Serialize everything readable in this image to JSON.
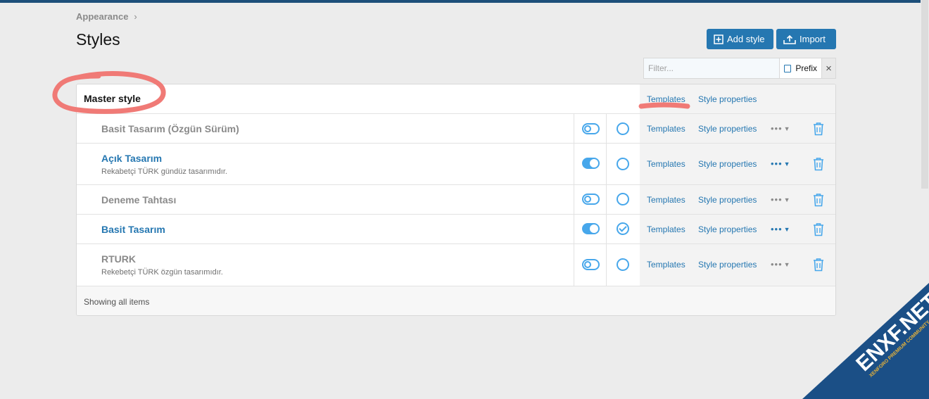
{
  "breadcrumb": {
    "label": "Appearance",
    "sep": "›"
  },
  "page": {
    "title": "Styles"
  },
  "toolbar": {
    "add_label": "Add style",
    "import_label": "Import"
  },
  "filter": {
    "placeholder": "Filter...",
    "prefix_label": "Prefix",
    "clear_icon": "×"
  },
  "master": {
    "title": "Master style",
    "templates": "Templates",
    "properties": "Style properties"
  },
  "styles": [
    {
      "title": "Basit Tasarım (Özgün Sürüm)",
      "desc": "",
      "enabled": false,
      "default": false,
      "templates": "Templates",
      "properties": "Style properties"
    },
    {
      "title": "Açık Tasarım",
      "desc": "Rekabetçi TÜRK gündüz tasarımıdır.",
      "enabled": true,
      "default": false,
      "templates": "Templates",
      "properties": "Style properties"
    },
    {
      "title": "Deneme Tahtası",
      "desc": "",
      "enabled": false,
      "default": false,
      "templates": "Templates",
      "properties": "Style properties"
    },
    {
      "title": "Basit Tasarım",
      "desc": "",
      "enabled": true,
      "default": true,
      "templates": "Templates",
      "properties": "Style properties"
    },
    {
      "title": "RTURK",
      "desc": "Rekebetçi TÜRK özgün tasarımıdır.",
      "enabled": false,
      "default": false,
      "templates": "Templates",
      "properties": "Style properties"
    }
  ],
  "footer": {
    "text": "Showing all items"
  },
  "watermark": {
    "text": "ENXF.NET",
    "sub": "XENFORO PREMIUM COMMUNITY"
  },
  "colors": {
    "accent": "#2577b1",
    "toggle": "#47a7eb",
    "annotation": "#f07a76"
  }
}
